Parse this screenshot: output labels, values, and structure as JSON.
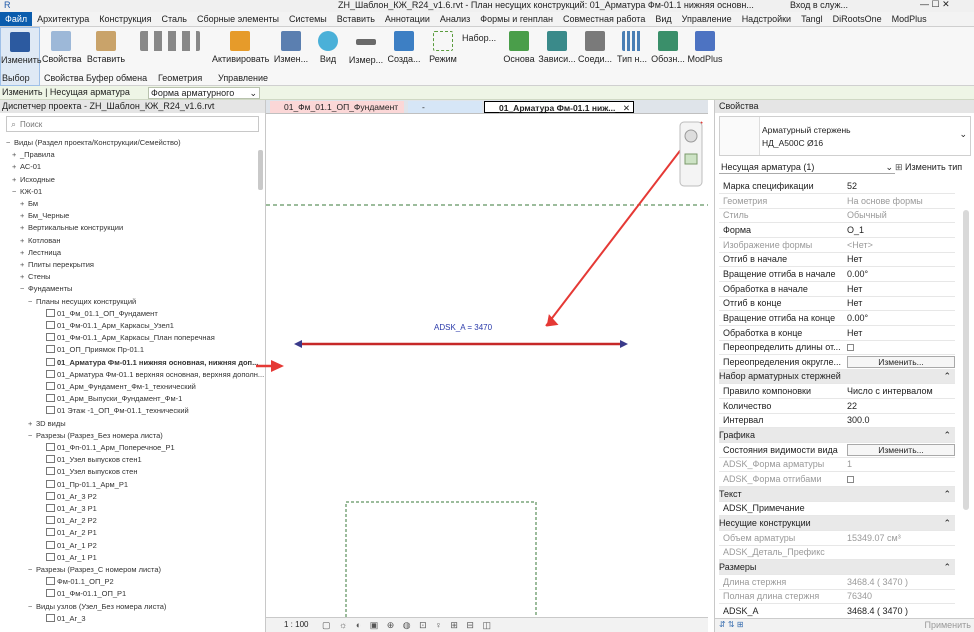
{
  "title_bar": {
    "text": "ZH_Шаблон_КЖ_R24_v1.6.rvt - План несущих конструкций: 01_Арматура Фм-01.1 нижняя основн...",
    "login": "Вход в служ..."
  },
  "menu": [
    "Файл",
    "Архитектура",
    "Конструкция",
    "Сталь",
    "Сборные элементы",
    "Системы",
    "Вставить",
    "Аннотации",
    "Анализ",
    "Формы и генплан",
    "Совместная работа",
    "Вид",
    "Управление",
    "Надстройки",
    "Tangl",
    "DiRootsOne",
    "ModPlus"
  ],
  "ribbon": {
    "buttons": [
      "Изменить",
      "Свойства",
      "Вставить",
      "Активировать",
      "Измен...",
      "Вид",
      "Измер...",
      "Созда...",
      "Режим",
      "Набор...",
      "Основа",
      "Зависи...",
      "Соеди...",
      "Тип н...",
      "Обозн...",
      "ModPlus"
    ],
    "panels": [
      "Выбор",
      "Свойства",
      "Буфер обмена",
      "Геометрия",
      "Управление"
    ]
  },
  "option_bar": {
    "context": "Изменить | Несущая арматура",
    "dropdown": "Форма арматурного"
  },
  "browser": {
    "title": "Диспетчер проекта - ZH_Шаблон_КЖ_R24_v1.6.rvt",
    "search_placeholder": "Поиск",
    "items": [
      {
        "t": "Виды (Раздел проекта/Конструкции/Семейство)",
        "l": 0,
        "g": "−",
        "icon": "views"
      },
      {
        "t": "_Правила",
        "l": 1,
        "g": "+"
      },
      {
        "t": "АС-01",
        "l": 1,
        "g": "+"
      },
      {
        "t": "Исходные",
        "l": 1,
        "g": "+"
      },
      {
        "t": "КЖ-01",
        "l": 1,
        "g": "−"
      },
      {
        "t": "Бм",
        "l": 2,
        "g": "+"
      },
      {
        "t": "Бм_Черные",
        "l": 2,
        "g": "+"
      },
      {
        "t": "Вертикальные конструкции",
        "l": 2,
        "g": "+"
      },
      {
        "t": "Котлован",
        "l": 2,
        "g": "+"
      },
      {
        "t": "Лестница",
        "l": 2,
        "g": "+"
      },
      {
        "t": "Плиты перекрытия",
        "l": 2,
        "g": "+"
      },
      {
        "t": "Стены",
        "l": 2,
        "g": "+"
      },
      {
        "t": "Фундаменты",
        "l": 2,
        "g": "−"
      },
      {
        "t": "Планы несущих конструкций",
        "l": 3,
        "g": "−"
      },
      {
        "t": "01_Фм_01.1_ОП_Фундамент",
        "l": 4,
        "v": true
      },
      {
        "t": "01_Фм-01.1_Арм_Каркасы_Узел1",
        "l": 4,
        "v": true
      },
      {
        "t": "01_Фм-01.1_Арм_Каркасы_План поперечная",
        "l": 4,
        "v": true
      },
      {
        "t": "01_ОП_Приямок Пр-01.1",
        "l": 4,
        "v": true
      },
      {
        "t": "01_Арматура Фм-01.1 нижняя основная, нижняя доп...",
        "l": 4,
        "v": true,
        "b": true
      },
      {
        "t": "01_Арматура Фм-01.1 верхняя основная, верхняя дополн...",
        "l": 4,
        "v": true
      },
      {
        "t": "01_Арм_Фундамент_Фм-1_технический",
        "l": 4,
        "v": true
      },
      {
        "t": "01_Арм_Выпуски_Фундамент_Фм-1",
        "l": 4,
        "v": true
      },
      {
        "t": "01 Этаж -1_ОП_Фм-01.1_технический",
        "l": 4,
        "v": true
      },
      {
        "t": "3D виды",
        "l": 3,
        "g": "+"
      },
      {
        "t": "Разрезы (Разрез_Без номера листа)",
        "l": 3,
        "g": "−"
      },
      {
        "t": "01_Фп-01.1_Арм_Поперечное_Р1",
        "l": 4,
        "v": true
      },
      {
        "t": "01_Узел выпусков стен1",
        "l": 4,
        "v": true
      },
      {
        "t": "01_Узел выпусков стен",
        "l": 4,
        "v": true
      },
      {
        "t": "01_Пр-01.1_Арм_Р1",
        "l": 4,
        "v": true
      },
      {
        "t": "01_Аг_3 Р2",
        "l": 4,
        "v": true
      },
      {
        "t": "01_Аг_3 Р1",
        "l": 4,
        "v": true
      },
      {
        "t": "01_Аг_2 Р2",
        "l": 4,
        "v": true
      },
      {
        "t": "01_Аг_2 Р1",
        "l": 4,
        "v": true
      },
      {
        "t": "01_Аг_1 Р2",
        "l": 4,
        "v": true
      },
      {
        "t": "01_Аг_1 Р1",
        "l": 4,
        "v": true
      },
      {
        "t": "Разрезы (Разрез_С номером листа)",
        "l": 3,
        "g": "−"
      },
      {
        "t": "Фм-01.1_ОП_Р2",
        "l": 4,
        "v": true
      },
      {
        "t": "01_Фм-01.1_ОП_Р1",
        "l": 4,
        "v": true
      },
      {
        "t": "Виды узлов (Узел_Без номера листа)",
        "l": 3,
        "g": "−"
      },
      {
        "t": "01_Аг_3",
        "l": 4,
        "v": true
      }
    ]
  },
  "view_tabs": [
    "01_Фм_01.1_ОП_Фундамент",
    "-",
    "01_Арматура Фм-01.1 ниж..."
  ],
  "canvas": {
    "dimension": "ADSK_A = 3470",
    "scale": "1 : 100"
  },
  "properties": {
    "title": "Свойства",
    "type_name": "Арматурный стержень",
    "type_sub": "НД_А500С Ø16",
    "instance": "Несущая арматура (1)",
    "edit_type": "Изменить тип",
    "rows": [
      {
        "k": "Марка спецификации",
        "v": "52"
      },
      {
        "k": "Геометрия",
        "v": "На основе формы",
        "d": true
      },
      {
        "k": "Стиль",
        "v": "Обычный",
        "d": true
      },
      {
        "k": "Форма",
        "v": "О_1"
      },
      {
        "k": "Изображение формы",
        "v": "<Нет>",
        "d": true
      },
      {
        "k": "Отгиб в начале",
        "v": "Нет"
      },
      {
        "k": "Вращение отгиба в начале",
        "v": "0.00°"
      },
      {
        "k": "Обработка в начале",
        "v": "Нет"
      },
      {
        "k": "Отгиб в конце",
        "v": "Нет"
      },
      {
        "k": "Вращение отгиба на конце",
        "v": "0.00°"
      },
      {
        "k": "Обработка в конце",
        "v": "Нет"
      },
      {
        "k": "Переопределить длины от...",
        "c": true
      },
      {
        "k": "Переопределения округле...",
        "btn": "Изменить..."
      },
      {
        "k": "Набор арматурных стержней",
        "s": true
      },
      {
        "k": "Правило компоновки",
        "v": "Число с интервалом"
      },
      {
        "k": "Количество",
        "v": "22"
      },
      {
        "k": "Интервал",
        "v": "300.0"
      },
      {
        "k": "Графика",
        "s": true
      },
      {
        "k": "Состояния видимости вида",
        "btn": "Изменить..."
      },
      {
        "k": "ADSK_Форма арматуры",
        "v": "1",
        "d": true
      },
      {
        "k": "ADSK_Форма отгибами",
        "c": true,
        "d": true
      },
      {
        "k": "Текст",
        "s": true
      },
      {
        "k": "ADSK_Примечание",
        "v": ""
      },
      {
        "k": "Несущие конструкции",
        "s": true
      },
      {
        "k": "Объем арматуры",
        "v": "15349.07 см³",
        "d": true
      },
      {
        "k": "ADSK_Деталь_Префикс",
        "v": "",
        "d": true
      },
      {
        "k": "Размеры",
        "s": true
      },
      {
        "k": "Длина стержня",
        "v": "3468.4 ( 3470 )",
        "d": true
      },
      {
        "k": "Полная длина стержня",
        "v": "76340",
        "d": true
      },
      {
        "k": "ADSK_A",
        "v": "3468.4 ( 3470 )"
      }
    ],
    "apply": "Применить"
  },
  "colors": {
    "accent": "#0a5cad",
    "annotation": "#e53935",
    "rebar": "#c62828"
  }
}
